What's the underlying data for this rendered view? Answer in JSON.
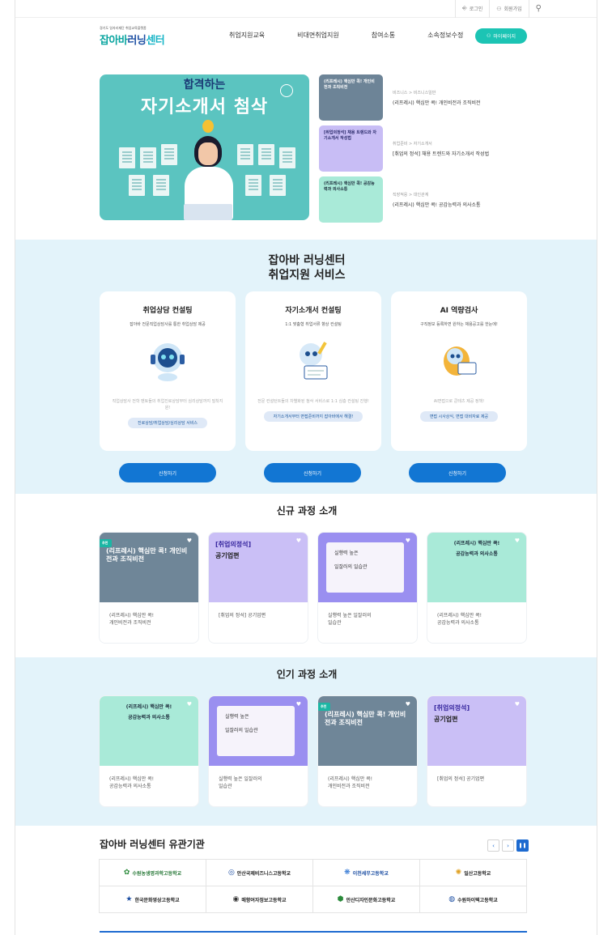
{
  "util": {
    "login": "로그인",
    "signup": "회원가입"
  },
  "header": {
    "logo_sub": "경기도 일자리재단 취업교육플랫폼",
    "logo_p1": "잡아바",
    "logo_p2": "러닝",
    "logo_p3": "센터",
    "nav": [
      "취업지원교육",
      "비대면취업지원",
      "참여소통",
      "소속정보수정"
    ],
    "mypage": "마이페이지"
  },
  "hero": {
    "banner_line1": "합격하는",
    "banner_line2": "자기소개서 첨삭",
    "items": [
      {
        "thumb": "(리프레시) 핵심만 콕! 개인비전과 조직비전",
        "category": "비즈니스 > 비즈니스일반",
        "title": "(리프레시) 핵심만 콕! 개인비전과 조직비전"
      },
      {
        "thumb": "[취업의정석] 채용 트렌드와 자기소개서 작성법",
        "category": "취업준비 > 자기소개서",
        "title": "[취업의 정석] 채용 트렌드와 자기소개서 작성법"
      },
      {
        "thumb": "(리프레시) 핵심만 콕! 공감능력과 의사소통",
        "category": "직장적응 > 대인관계",
        "title": "(리프레시) 핵심만 콕! 공감능력과 의사소통"
      }
    ]
  },
  "service": {
    "title_line1": "잡아바 러닝센터",
    "title_line2": "취업지원 서비스",
    "cards": [
      {
        "name": "취업상담 컨설팅",
        "desc": "잡아바 전문직업상담사를 통한 취업상담 제공",
        "note": "직업상담사 전학 멘토들의 취업진로상담부터 심리상담까지 밀착지원!",
        "tag": "진로상담/취업상담/심리상담 서비스",
        "apply": "신청하기"
      },
      {
        "name": "자기소개서 컨설팅",
        "desc": "1:1 맞춤형 취업서류 향상 컨설팅",
        "note": "전문 컨설턴트들의 차별화된 첨삭 서비스로 1:1 심층 컨설팅 진행!",
        "tag": "자기소개서부터 면접준비까지 잡아바에서 해결!",
        "apply": "신청하기"
      },
      {
        "name": "AI 역량검사",
        "desc": "구직정보 등록하면 원하는 채용공고를 한눈에!",
        "note": "AI면접으로 쿤테츠 제공 정책!",
        "tag": "면접 시사상식, 면접 대비자료 제공",
        "apply": "신청하기"
      }
    ]
  },
  "new_courses": {
    "title": "신규 과정 소개",
    "cards": [
      {
        "thumb": "(리프레시) 핵심만 콕! 개인비전과 조직비전",
        "title_l1": "(리프레시) 핵심만 콕!",
        "title_l2": "개인비전과 조직비전",
        "badge": "추천"
      },
      {
        "thumb_l1": "[취업의정석]",
        "thumb_l2": "공기업편",
        "title_l1": "[취업의 정석] 공기업편",
        "title_l2": ""
      },
      {
        "thumb_l1": "실행력 높은",
        "thumb_l2": "일잘러의 일습관",
        "title_l1": "실행력 높은 일잘러의",
        "title_l2": "일습관"
      },
      {
        "thumb_l1": "(리프레시) 핵심만 콕!",
        "thumb_l2": "공감능력과 의사소통",
        "title_l1": "(리프레시) 핵심만 콕!",
        "title_l2": "공감능력과 의사소통"
      }
    ]
  },
  "pop_courses": {
    "title": "인기 과정 소개",
    "cards": [
      {
        "thumb_l1": "(리프레시) 핵심만 콕!",
        "thumb_l2": "공감능력과 의사소통",
        "title_l1": "(리프레시) 핵심만 콕!",
        "title_l2": "공감능력과 의사소통"
      },
      {
        "thumb_l1": "실행력 높은",
        "thumb_l2": "일잘러의 일습관",
        "title_l1": "실행력 높은 일잘러의",
        "title_l2": "일습관"
      },
      {
        "thumb": "(리프레시) 핵심만 콕! 개인비전과 조직비전",
        "title_l1": "(리프레시) 핵심만 콕!",
        "title_l2": "개인비전과 조직비전",
        "badge": "추천"
      },
      {
        "thumb_l1": "[취업의정석]",
        "thumb_l2": "공기업편",
        "title_l1": "[취업의 정석] 공기업편",
        "title_l2": ""
      }
    ]
  },
  "partners": {
    "title": "잡아바 러닝센터 유관기관",
    "list": [
      "수원농생명과학고등학교",
      "안산국제비즈니스고등학교",
      "이천세무고등학교",
      "일산고등학교",
      "한국문화영상고등학교",
      "매향여자정보고등학교",
      "안산디자인문화고등학교",
      "수원하이텍고등학교"
    ]
  },
  "colors": {
    "accent": "#1cc4b4",
    "primary_blue": "#1276d3",
    "section_bg": "#e3f3fa"
  }
}
